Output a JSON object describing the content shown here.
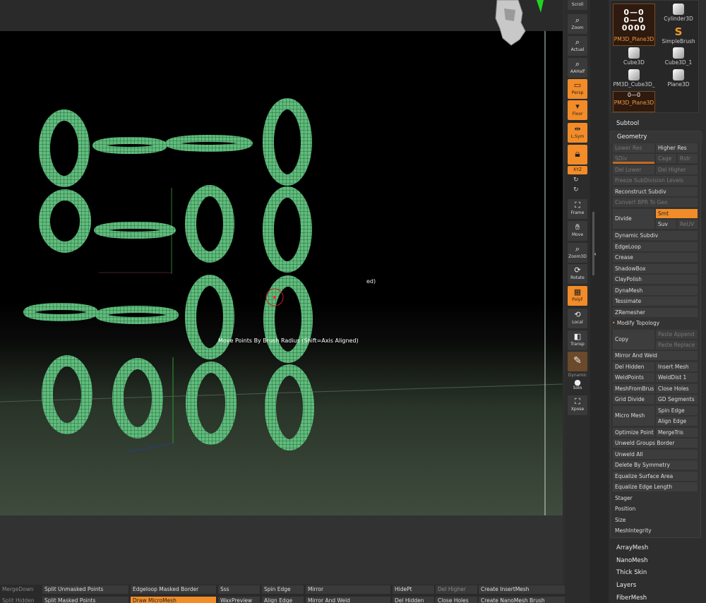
{
  "viewport": {
    "status_text": "ed)",
    "tooltip": "Move Points By Brush Radius (Shift=Axis Aligned)"
  },
  "rail": {
    "scroll": "Scroll",
    "zoom": "Zoom",
    "actual": "Actual",
    "aahalf": "AAHalf",
    "persp": "Persp",
    "floor": "Floor",
    "lsym": "L.Sym",
    "xyz": "XYZ",
    "frame": "Frame",
    "move": "Move",
    "zoom3d": "Zoom3D",
    "rotate": "Rotate",
    "polyf": "PolyF",
    "local": "Local",
    "transp": "Transp",
    "dynamic": "Dynamic",
    "solo": "Solo",
    "xpose": "Xpose"
  },
  "tools": [
    {
      "label": "PM3D_Plane3D",
      "selected": true
    },
    {
      "label": "Cylinder3D",
      "selected": false
    },
    {
      "label": "SimpleBrush",
      "selected": false
    },
    {
      "label": "Cube3D",
      "selected": false
    },
    {
      "label": "Cube3D_1",
      "selected": false
    },
    {
      "label": "PM3D_Cube3D_",
      "selected": false
    },
    {
      "label": "Plane3D",
      "selected": false
    },
    {
      "label": "PM3D_Plane3D",
      "selected": false
    }
  ],
  "panel": {
    "subtool": "Subtool",
    "geometry": "Geometry",
    "lower_res": "Lower Res",
    "higher_res": "Higher Res",
    "sdiv": "SDiv",
    "cage": "Cage",
    "rstr": "Rstr",
    "del_lower": "Del Lower",
    "del_higher": "Del Higher",
    "freeze": "Freeze SubDivision Levels",
    "reconstruct": "Reconstruct Subdiv",
    "convert_bpr": "Convert BPR To Geo",
    "divide": "Divide",
    "smt": "Smt",
    "suv": "Suv",
    "reuv": "ReUV",
    "dynamic_subdiv": "Dynamic Subdiv",
    "edgeloop": "EdgeLoop",
    "crease": "Crease",
    "shadowbox": "ShadowBox",
    "claypolish": "ClayPolish",
    "dynamesh": "DynaMesh",
    "tessimate": "Tessimate",
    "zremesher": "ZRemesher",
    "modify_topology": "Modify Topology",
    "copy": "Copy",
    "paste_append": "Paste Append",
    "paste_replace": "Paste Replace",
    "mirror_weld": "Mirror And Weld",
    "del_hidden": "Del Hidden",
    "insert_mesh": "Insert Mesh",
    "weldpoints": "WeldPoints",
    "welddist": "WeldDist 1",
    "meshfrombrush": "MeshFromBrus",
    "close_holes": "Close Holes",
    "grid_divide": "Grid Divide",
    "gd_segments": "GD Segments",
    "micro_mesh": "Micro Mesh",
    "spin_edge": "Spin Edge",
    "align_edge": "Align Edge",
    "optimize_points": "Optimize Point",
    "mergetris": "MergeTris",
    "unweld_groups": "Unweld Groups Border",
    "unweld_all": "Unweld All",
    "delete_symmetry": "Delete By Symmetry",
    "equalize_surface": "Equalize Surface Area",
    "equalize_edge": "Equalize Edge Length",
    "stager": "Stager",
    "position": "Position",
    "size": "Size",
    "meshintegrity": "MeshIntegrity",
    "arraymesh": "ArrayMesh",
    "nanomesh": "NanoMesh",
    "thick_skin": "Thick Skin",
    "layers": "Layers",
    "fibermesh": "FiberMesh"
  },
  "bottom": {
    "row1": [
      "MergeDown",
      "Split Unmasked Points",
      "Edgeloop Masked Border",
      "Sss",
      "Spin Edge",
      "Mirror",
      "HidePt",
      "Del Higher",
      "Create InsertMesh"
    ],
    "row2": [
      "Split Hidden",
      "Split Masked Points",
      "Draw MicroMesh",
      "WaxPreview",
      "Align Edge",
      "Mirror And Weld",
      "Del Hidden",
      "Close Holes",
      "Create NanoMesh Brush"
    ]
  },
  "colors": {
    "accent": "#f28c28",
    "mesh": "#4fae6e"
  }
}
